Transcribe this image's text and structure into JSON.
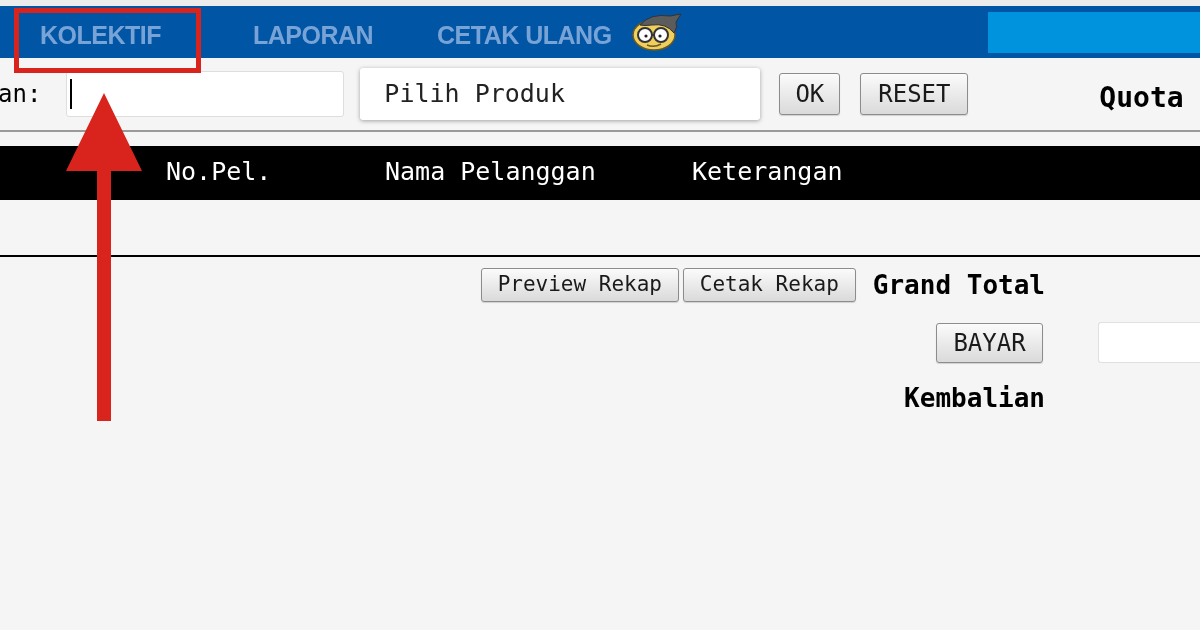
{
  "nav": {
    "tabs": [
      {
        "label": "KOLEKTIF"
      },
      {
        "label": "LAPORAN"
      },
      {
        "label": "CETAK ULANG"
      }
    ]
  },
  "toolbar": {
    "field_label": "an:",
    "customer_field": {
      "focused": true
    },
    "product_select": {
      "label": "Pilih Produk"
    },
    "buttons": [
      "OK",
      "RESET"
    ],
    "quota_label": "Quota"
  },
  "table": {
    "columns": [
      "No.Pel.",
      "Nama Pelanggan",
      "Keterangan"
    ]
  },
  "summary": {
    "buttons": [
      "Preview Rekap",
      "Cetak Rekap"
    ],
    "grand_total_label": "Grand Total",
    "pay_button": "BAYAR",
    "change_label": "Kembalian"
  },
  "annotation": {
    "highlight_frame": true,
    "arrow": true
  }
}
